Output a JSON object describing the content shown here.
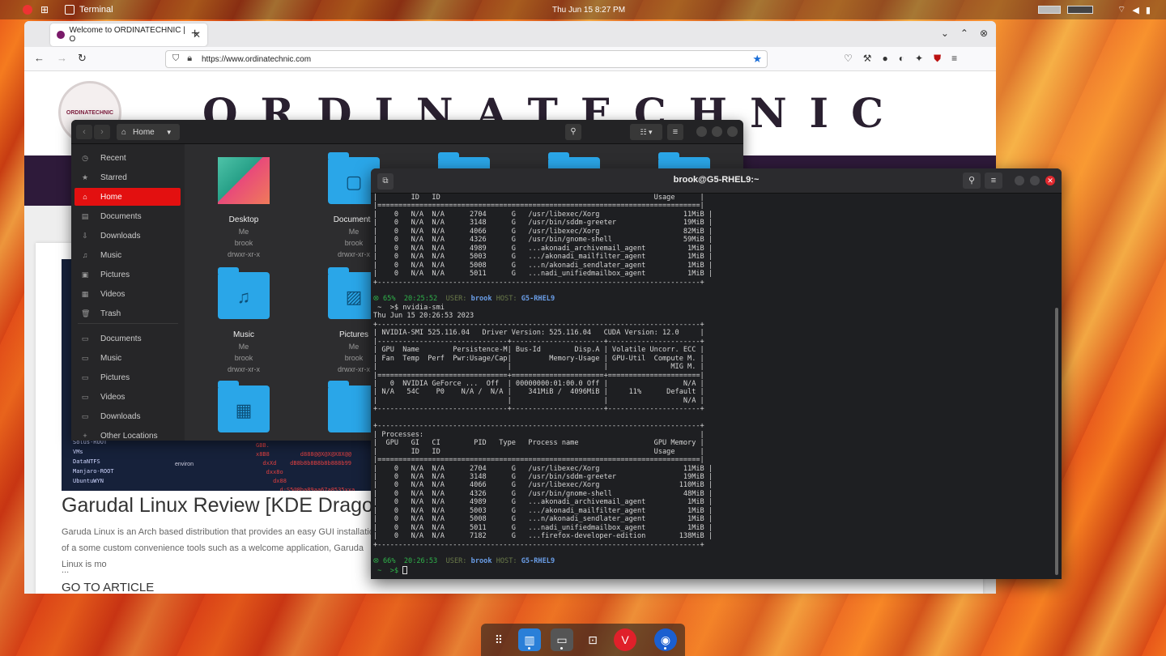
{
  "topbar": {
    "active_app": "Terminal",
    "clock": "Thu Jun 15  8:27 PM"
  },
  "browser": {
    "tab_title": "Welcome to ORDINATECHNIC | O",
    "url": "https://www.ordinatechnic.com",
    "site_logo_text": "ORDINATECHNIC",
    "site_title": "ORDINATECHNIC",
    "article": {
      "title": "Garudal Linux Review [KDE Dragonize",
      "text": "Garuda Linux is an Arch based distribution that provides an easy GUI installation of a some custom convenience tools such as a welcome application, Garuda Linux is mo",
      "dots": "...",
      "link": "GO TO ARTICLE",
      "img_lines": [
        "Solus-ROOT",
        "VMs",
        "DataNTFS",
        "Manjaro-ROOT",
        "UbuntuWYN"
      ],
      "img_code": [
        "GBB.",
        "x8B8         d888@@X@X@X8X@@",
        "  dxXd    dB8b8b8B8b8b888b99",
        "   dxx8o",
        "     dx88",
        "       d:S5@8ba89aa67a8535xxa"
      ],
      "img_label": "environ"
    }
  },
  "files": {
    "path": "Home",
    "sidebar": [
      {
        "label": "Recent",
        "icon": "◷"
      },
      {
        "label": "Starred",
        "icon": "★"
      },
      {
        "label": "Home",
        "icon": "⌂"
      },
      {
        "label": "Documents",
        "icon": "▤"
      },
      {
        "label": "Downloads",
        "icon": "⇩"
      },
      {
        "label": "Music",
        "icon": "♫"
      },
      {
        "label": "Pictures",
        "icon": "▣"
      },
      {
        "label": "Videos",
        "icon": "▦"
      },
      {
        "label": "Trash",
        "icon": "🗑"
      },
      {
        "label": "Documents",
        "icon": "▭"
      },
      {
        "label": "Music",
        "icon": "▭"
      },
      {
        "label": "Pictures",
        "icon": "▭"
      },
      {
        "label": "Videos",
        "icon": "▭"
      },
      {
        "label": "Downloads",
        "icon": "▭"
      },
      {
        "label": "Other Locations",
        "icon": "+"
      }
    ],
    "items": [
      {
        "name": "Desktop",
        "owner": "Me",
        "group": "brook",
        "perms": "drwxr-xr-x"
      },
      {
        "name": "Documents",
        "owner": "Me",
        "group": "brook",
        "perms": "drwxr-xr-x"
      },
      {
        "name": "Music",
        "owner": "Me",
        "group": "brook",
        "perms": "drwxr-xr-x"
      },
      {
        "name": "Pictures",
        "owner": "Me",
        "group": "brook",
        "perms": "drwxr-xr-x"
      }
    ]
  },
  "terminal": {
    "title": "brook@G5-RHEL9:~",
    "lines": [
      "|        ID   ID                                                   Usage      |",
      "|=============================================================================|",
      "|    0   N/A  N/A      2704      G   /usr/libexec/Xorg                    11MiB |",
      "|    0   N/A  N/A      3148      G   /usr/bin/sddm-greeter                19MiB |",
      "|    0   N/A  N/A      4066      G   /usr/libexec/Xorg                    82MiB |",
      "|    0   N/A  N/A      4326      G   /usr/bin/gnome-shell                 59MiB |",
      "|    0   N/A  N/A      4989      G   ...akonadi_archivemail_agent          1MiB |",
      "|    0   N/A  N/A      5003      G   .../akonadi_mailfilter_agent          1MiB |",
      "|    0   N/A  N/A      5008      G   ...n/akonadi_sendlater_agent          1MiB |",
      "|    0   N/A  N/A      5011      G   ...nadi_unifiedmailbox_agent          1MiB |",
      "+-----------------------------------------------------------------------------+",
      "",
      "PROMPT1",
      " ~  >$ nvidia-smi",
      "Thu Jun 15 20:26:53 2023",
      "+-----------------------------------------------------------------------------+",
      "| NVIDIA-SMI 525.116.04   Driver Version: 525.116.04   CUDA Version: 12.0     |",
      "|-------------------------------+----------------------+----------------------+",
      "| GPU  Name        Persistence-M| Bus-Id        Disp.A | Volatile Uncorr. ECC |",
      "| Fan  Temp  Perf  Pwr:Usage/Cap|         Memory-Usage | GPU-Util  Compute M. |",
      "|                               |                      |               MIG M. |",
      "|===============================+======================+======================|",
      "|   0  NVIDIA GeForce ...  Off  | 00000000:01:00.0 Off |                  N/A |",
      "| N/A   54C    P0    N/A /  N/A |    341MiB /  4096MiB |     11%      Default |",
      "|                               |                      |                  N/A |",
      "+-------------------------------+----------------------+----------------------+",
      "",
      "+-----------------------------------------------------------------------------+",
      "| Processes:                                                                  |",
      "|  GPU   GI   CI        PID   Type   Process name                  GPU Memory |",
      "|        ID   ID                                                   Usage      |",
      "|=============================================================================|",
      "|    0   N/A  N/A      2704      G   /usr/libexec/Xorg                    11MiB |",
      "|    0   N/A  N/A      3148      G   /usr/bin/sddm-greeter                19MiB |",
      "|    0   N/A  N/A      4066      G   /usr/libexec/Xorg                   110MiB |",
      "|    0   N/A  N/A      4326      G   /usr/bin/gnome-shell                 48MiB |",
      "|    0   N/A  N/A      4989      G   ...akonadi_archivemail_agent          1MiB |",
      "|    0   N/A  N/A      5003      G   .../akonadi_mailfilter_agent          1MiB |",
      "|    0   N/A  N/A      5008      G   ...n/akonadi_sendlater_agent          1MiB |",
      "|    0   N/A  N/A      5011      G   ...nadi_unifiedmailbox_agent          1MiB |",
      "|    0   N/A  N/A      7182      G   ...firefox-developer-edition        138MiB |",
      "+-----------------------------------------------------------------------------+",
      "",
      "PROMPT2",
      "PROMPTCMD"
    ],
    "prompt1": {
      "bat": "65%",
      "time": "20:25:52",
      "user_label": "USER:",
      "user": "brook",
      "host_label": "HOST:",
      "host": "G5-RHEL9"
    },
    "prompt2": {
      "bat": "66%",
      "time": "20:26:53",
      "user_label": "USER:",
      "user": "brook",
      "host_label": "HOST:",
      "host": "G5-RHEL9"
    },
    "prompt_symbol": " ~  >$ "
  },
  "dock": {
    "items": [
      "app-grid",
      "files",
      "terminal",
      "software",
      "vivaldi",
      "firefox"
    ]
  }
}
